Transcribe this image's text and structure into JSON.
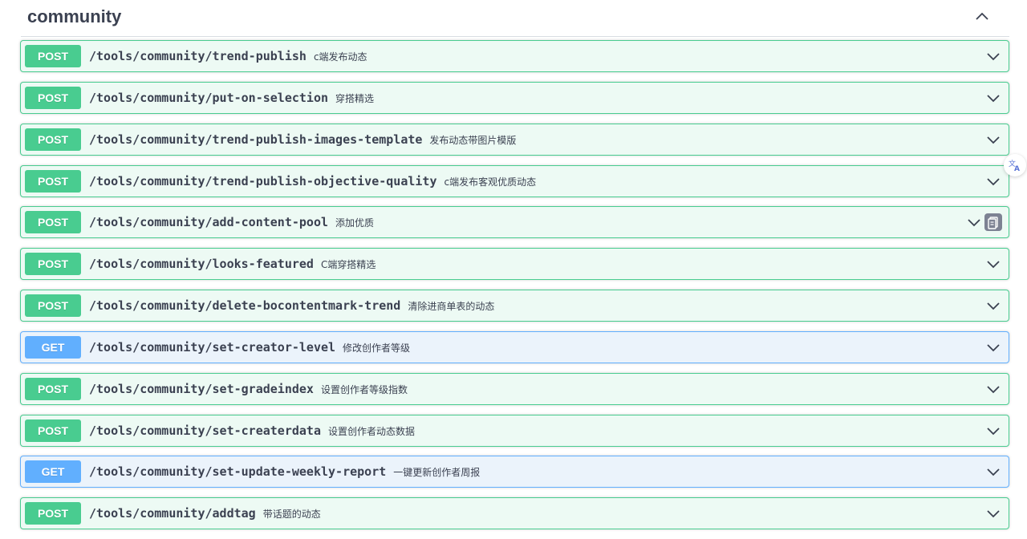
{
  "section": {
    "title": "community",
    "collapse_icon": "chevron-up-icon"
  },
  "colors": {
    "post_accent": "#49cc90",
    "post_background": "#edfaf4",
    "get_accent": "#61affe",
    "get_background": "#ebf3fb",
    "text": "#3b4151"
  },
  "operations": [
    {
      "method": "POST",
      "path": "/tools/community/trend-publish",
      "summary": "c端发布动态"
    },
    {
      "method": "POST",
      "path": "/tools/community/put-on-selection",
      "summary": "穿搭精选"
    },
    {
      "method": "POST",
      "path": "/tools/community/trend-publish-images-template",
      "summary": "发布动态带图片模版"
    },
    {
      "method": "POST",
      "path": "/tools/community/trend-publish-objective-quality",
      "summary": "c端发布客观优质动态"
    },
    {
      "method": "POST",
      "path": "/tools/community/add-content-pool",
      "summary": "添加优质"
    },
    {
      "method": "POST",
      "path": "/tools/community/looks-featured",
      "summary": "C端穿搭精选"
    },
    {
      "method": "POST",
      "path": "/tools/community/delete-bocontentmark-trend",
      "summary": "清除进商单表的动态"
    },
    {
      "method": "GET",
      "path": "/tools/community/set-creator-level",
      "summary": "修改创作者等级"
    },
    {
      "method": "POST",
      "path": "/tools/community/set-gradeindex",
      "summary": "设置创作者等级指数"
    },
    {
      "method": "POST",
      "path": "/tools/community/set-createrdata",
      "summary": "设置创作者动态数据"
    },
    {
      "method": "GET",
      "path": "/tools/community/set-update-weekly-report",
      "summary": "一键更新创作者周报"
    },
    {
      "method": "POST",
      "path": "/tools/community/addtag",
      "summary": "带话题的动态"
    }
  ],
  "row_icons": {
    "expand": "chevron-down-icon",
    "copy": "copy-icon"
  },
  "floating": {
    "translate_icon": "translate-icon"
  }
}
